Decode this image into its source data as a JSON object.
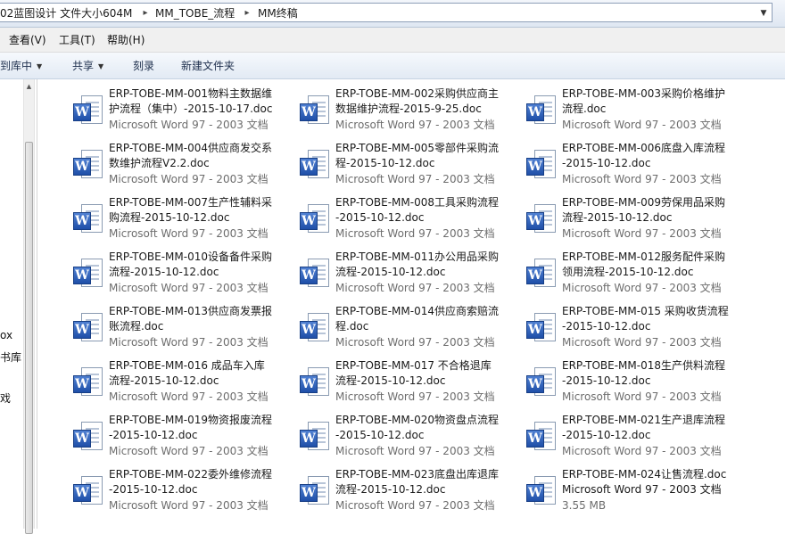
{
  "address_bar": {
    "crumbs": [
      "02蓝图设计 文件大小604M",
      "MM_TOBE_流程",
      "MM终稿"
    ],
    "separator": "▸",
    "dropdown": "▼"
  },
  "menu": [
    "查看(V)",
    "工具(T)",
    "帮助(H)"
  ],
  "commands": [
    {
      "label": "到库中",
      "has_caret": true
    },
    {
      "label": "共享",
      "has_caret": true
    },
    {
      "label": "刻录",
      "has_caret": false
    },
    {
      "label": "新建文件夹",
      "has_caret": false
    }
  ],
  "caret": "▼",
  "nav_fragments": [
    "ox",
    "书库",
    "戏"
  ],
  "scroll_up": "▲",
  "files": [
    {
      "line1": "ERP-TOBE-MM-001物料主数据维",
      "line2": "护流程（集中）-2015-10-17.doc",
      "line3": "Microsoft Word 97 - 2003 文档"
    },
    {
      "line1": "ERP-TOBE-MM-002采购供应商主",
      "line2": "数据维护流程-2015-9-25.doc",
      "line3": "Microsoft Word 97 - 2003 文档"
    },
    {
      "line1": "ERP-TOBE-MM-003采购价格维护",
      "line2": "流程.doc",
      "line3": "Microsoft Word 97 - 2003 文档"
    },
    {
      "line1": "ERP-TOBE-MM-004供应商发交系",
      "line2": "数维护流程V2.2.doc",
      "line3": "Microsoft Word 97 - 2003 文档"
    },
    {
      "line1": "ERP-TOBE-MM-005零部件采购流",
      "line2": "程-2015-10-12.doc",
      "line3": "Microsoft Word 97 - 2003 文档"
    },
    {
      "line1": "ERP-TOBE-MM-006底盘入库流程",
      "line2": "-2015-10-12.doc",
      "line3": "Microsoft Word 97 - 2003 文档"
    },
    {
      "line1": "ERP-TOBE-MM-007生产性辅料采",
      "line2": "购流程-2015-10-12.doc",
      "line3": "Microsoft Word 97 - 2003 文档"
    },
    {
      "line1": "ERP-TOBE-MM-008工具采购流程",
      "line2": "-2015-10-12.doc",
      "line3": "Microsoft Word 97 - 2003 文档"
    },
    {
      "line1": "ERP-TOBE-MM-009劳保用品采购",
      "line2": "流程-2015-10-12.doc",
      "line3": "Microsoft Word 97 - 2003 文档"
    },
    {
      "line1": "ERP-TOBE-MM-010设备备件采购",
      "line2": "流程-2015-10-12.doc",
      "line3": "Microsoft Word 97 - 2003 文档"
    },
    {
      "line1": "ERP-TOBE-MM-011办公用品采购",
      "line2": "流程-2015-10-12.doc",
      "line3": "Microsoft Word 97 - 2003 文档"
    },
    {
      "line1": "ERP-TOBE-MM-012服务配件采购",
      "line2": "领用流程-2015-10-12.doc",
      "line3": "Microsoft Word 97 - 2003 文档"
    },
    {
      "line1": "ERP-TOBE-MM-013供应商发票报",
      "line2": "账流程.doc",
      "line3": "Microsoft Word 97 - 2003 文档"
    },
    {
      "line1": "ERP-TOBE-MM-014供应商索赔流",
      "line2": "程.doc",
      "line3": "Microsoft Word 97 - 2003 文档"
    },
    {
      "line1": "ERP-TOBE-MM-015 采购收货流程",
      "line2": "-2015-10-12.doc",
      "line3": "Microsoft Word 97 - 2003 文档"
    },
    {
      "line1": "ERP-TOBE-MM-016 成品车入库",
      "line2": "流程-2015-10-12.doc",
      "line3": "Microsoft Word 97 - 2003 文档"
    },
    {
      "line1": "ERP-TOBE-MM-017 不合格退库",
      "line2": "流程-2015-10-12.doc",
      "line3": "Microsoft Word 97 - 2003 文档"
    },
    {
      "line1": "ERP-TOBE-MM-018生产供料流程",
      "line2": "-2015-10-12.doc",
      "line3": "Microsoft Word 97 - 2003 文档"
    },
    {
      "line1": "ERP-TOBE-MM-019物资报废流程",
      "line2": "-2015-10-12.doc",
      "line3": "Microsoft Word 97 - 2003 文档"
    },
    {
      "line1": "ERP-TOBE-MM-020物资盘点流程",
      "line2": "-2015-10-12.doc",
      "line3": "Microsoft Word 97 - 2003 文档"
    },
    {
      "line1": "ERP-TOBE-MM-021生产退库流程",
      "line2": "-2015-10-12.doc",
      "line3": "Microsoft Word 97 - 2003 文档"
    },
    {
      "line1": "ERP-TOBE-MM-022委外维修流程",
      "line2": "-2015-10-12.doc",
      "line3": "Microsoft Word 97 - 2003 文档"
    },
    {
      "line1": "ERP-TOBE-MM-023底盘出库退库",
      "line2": "流程-2015-10-12.doc",
      "line3": "Microsoft Word 97 - 2003 文档"
    },
    {
      "line1": "ERP-TOBE-MM-024让售流程.doc",
      "line2": "Microsoft Word 97 - 2003 文档",
      "line3": "3.55 MB",
      "two_line_name": false
    }
  ],
  "file_icon": "word-doc-icon",
  "word_glyph": "W"
}
